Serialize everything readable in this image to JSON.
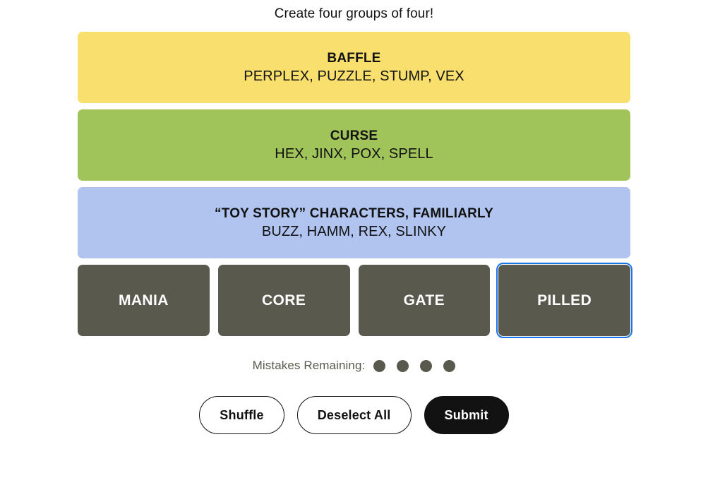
{
  "header": {
    "instruction": "Create four groups of four!"
  },
  "solved_groups": [
    {
      "title": "BAFFLE",
      "members": "PERPLEX, PUZZLE, STUMP, VEX",
      "color": "#f9df6d",
      "difficulty": "yellow"
    },
    {
      "title": "CURSE",
      "members": "HEX, JINX, POX, SPELL",
      "color": "#a0c35a",
      "difficulty": "green"
    },
    {
      "title": "“TOY STORY” CHARACTERS, FAMILIARLY",
      "members": "BUZZ, HAMM, REX, SLINKY",
      "color": "#b0c4ef",
      "difficulty": "blue"
    }
  ],
  "tiles": [
    {
      "label": "MANIA",
      "focused": false
    },
    {
      "label": "CORE",
      "focused": false
    },
    {
      "label": "GATE",
      "focused": false
    },
    {
      "label": "PILLED",
      "focused": true
    }
  ],
  "mistakes": {
    "label": "Mistakes Remaining:",
    "remaining": 4,
    "dot_color": "#5a594e"
  },
  "buttons": {
    "shuffle": "Shuffle",
    "deselect_all": "Deselect All",
    "submit": "Submit"
  },
  "colors": {
    "tile_background": "#5a594e",
    "tile_text": "#ffffff",
    "focus_ring": "#1a73e8",
    "page_background": "#ffffff",
    "text": "#121212"
  }
}
